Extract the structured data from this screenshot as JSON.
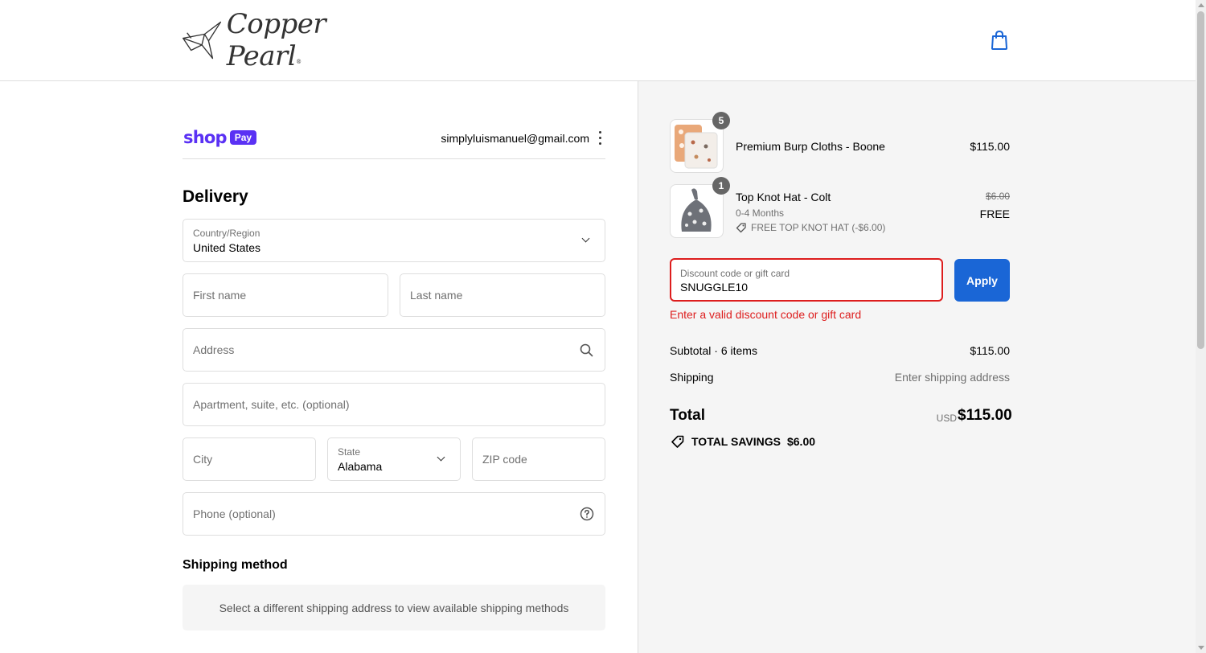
{
  "header": {
    "brand": "Copper Pearl",
    "brand_mark": "®",
    "cart_icon": "shopping-bag-icon"
  },
  "account": {
    "shop_label": "shop",
    "pay_label": "Pay",
    "email": "simplyluismanuel@gmail.com",
    "menu_icon": "kebab-icon"
  },
  "delivery": {
    "heading": "Delivery",
    "country": {
      "label": "Country/Region",
      "value": "United States"
    },
    "first_name": {
      "placeholder": "First name",
      "value": ""
    },
    "last_name": {
      "placeholder": "Last name",
      "value": ""
    },
    "address": {
      "placeholder": "Address",
      "value": "",
      "icon": "search-icon"
    },
    "apartment": {
      "placeholder": "Apartment, suite, etc. (optional)",
      "value": ""
    },
    "city": {
      "placeholder": "City",
      "value": ""
    },
    "state": {
      "label": "State",
      "value": "Alabama"
    },
    "zip": {
      "placeholder": "ZIP code",
      "value": ""
    },
    "phone": {
      "placeholder": "Phone (optional)",
      "value": "",
      "icon": "help-circle-icon"
    }
  },
  "shipping_method": {
    "heading": "Shipping method",
    "message": "Select a different shipping address to view available shipping methods"
  },
  "order": {
    "items": [
      {
        "name": "Premium Burp Cloths - Boone",
        "quantity": "5",
        "price": "$115.00"
      },
      {
        "name": "Top Knot Hat - Colt",
        "quantity": "1",
        "variant": "0-4 Months",
        "discount": "FREE TOP KNOT HAT (-$6.00)",
        "original_price": "$6.00",
        "price": "FREE"
      }
    ],
    "discount": {
      "label": "Discount code or gift card",
      "value": "SNUGGLE10",
      "button": "Apply",
      "error": "Enter a valid discount code or gift card"
    },
    "subtotal_label": "Subtotal · 6 items",
    "subtotal_value": "$115.00",
    "shipping_label": "Shipping",
    "shipping_value": "Enter shipping address",
    "total_label": "Total",
    "currency": "USD",
    "total_value": "$115.00",
    "savings_label": "TOTAL SAVINGS",
    "savings_value": "$6.00"
  },
  "colors": {
    "shop_pay": "#5a31f4",
    "accent": "#1a66d6",
    "error": "#dd1d1d",
    "summary_bg": "#f5f5f5"
  }
}
